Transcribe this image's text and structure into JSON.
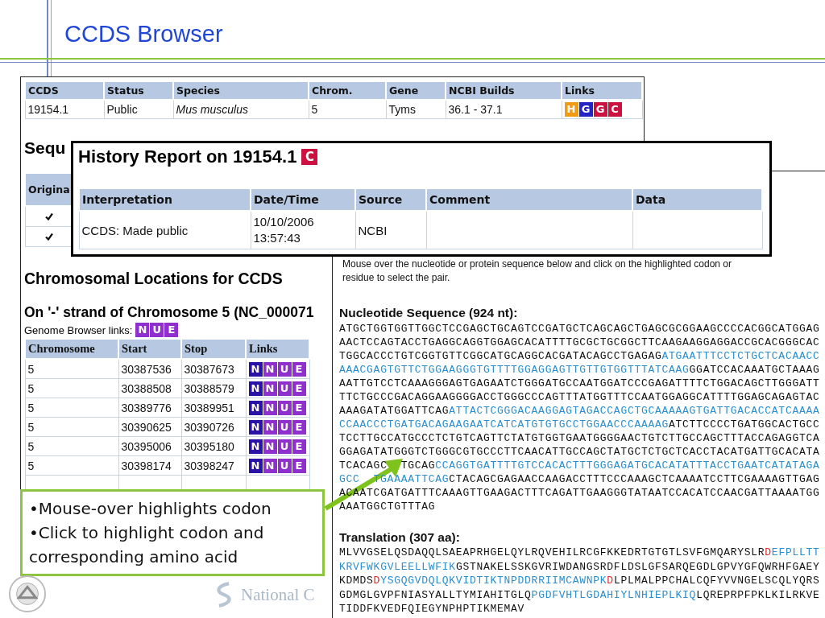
{
  "slide": {
    "title": "CCDS Browser",
    "footer_logo": "National C"
  },
  "ccds_page": {
    "summary_table": {
      "columns": [
        "CCDS",
        "Status",
        "Species",
        "Chrom.",
        "Gene",
        "NCBI Builds",
        "Links"
      ],
      "rows": [
        {
          "ccds": "19154.1",
          "status": "Public",
          "species": "Mus musculus",
          "chrom": "5",
          "gene": "Tyms",
          "ncbi_builds": "36.1 - 37.1",
          "links": [
            {
              "label": "H",
              "color": "#f29a12"
            },
            {
              "label": "G",
              "color": "#2323c8"
            },
            {
              "label": "G",
              "color": "#cc1040"
            },
            {
              "label": "C",
              "color": "#cc1040"
            }
          ]
        }
      ]
    },
    "sequence_heading": "Sequ",
    "original_table": {
      "column": "Origina",
      "rows": [
        {
          "checked": true
        },
        {
          "checked": true
        }
      ]
    },
    "locations_heading": "Chromosomal Locations for CCDS",
    "strand_heading": "On '-' strand of Chromosome 5 (NC_000071",
    "genome_browser": {
      "label": "Genome Browser links:",
      "links": [
        {
          "label": "N",
          "color": "#8e2fce"
        },
        {
          "label": "U",
          "color": "#8e2fce"
        },
        {
          "label": "E",
          "color": "#8e2fce"
        }
      ]
    },
    "locations_table": {
      "columns": [
        "Chromosome",
        "Start",
        "Stop",
        "Links"
      ],
      "rows": [
        {
          "chromosome": "5",
          "start": "30387536",
          "stop": "30387673",
          "links": [
            {
              "label": "N",
              "color": "#2a12a8"
            },
            {
              "label": "N",
              "color": "#8e2fce"
            },
            {
              "label": "U",
              "color": "#8e2fce"
            },
            {
              "label": "E",
              "color": "#8e2fce"
            }
          ]
        },
        {
          "chromosome": "5",
          "start": "30388508",
          "stop": "30388579",
          "links": [
            {
              "label": "N",
              "color": "#2a12a8"
            },
            {
              "label": "N",
              "color": "#8e2fce"
            },
            {
              "label": "U",
              "color": "#8e2fce"
            },
            {
              "label": "E",
              "color": "#8e2fce"
            }
          ]
        },
        {
          "chromosome": "5",
          "start": "30389776",
          "stop": "30389951",
          "links": [
            {
              "label": "N",
              "color": "#2a12a8"
            },
            {
              "label": "N",
              "color": "#8e2fce"
            },
            {
              "label": "U",
              "color": "#8e2fce"
            },
            {
              "label": "E",
              "color": "#8e2fce"
            }
          ]
        },
        {
          "chromosome": "5",
          "start": "30390625",
          "stop": "30390726",
          "links": [
            {
              "label": "N",
              "color": "#2a12a8"
            },
            {
              "label": "N",
              "color": "#8e2fce"
            },
            {
              "label": "U",
              "color": "#8e2fce"
            },
            {
              "label": "E",
              "color": "#8e2fce"
            }
          ]
        },
        {
          "chromosome": "5",
          "start": "30395006",
          "stop": "30395180",
          "links": [
            {
              "label": "N",
              "color": "#2a12a8"
            },
            {
              "label": "N",
              "color": "#8e2fce"
            },
            {
              "label": "U",
              "color": "#8e2fce"
            },
            {
              "label": "E",
              "color": "#8e2fce"
            }
          ]
        },
        {
          "chromosome": "5",
          "start": "30398174",
          "stop": "30398247",
          "links": [
            {
              "label": "N",
              "color": "#2a12a8"
            },
            {
              "label": "N",
              "color": "#8e2fce"
            },
            {
              "label": "U",
              "color": "#8e2fce"
            },
            {
              "label": "E",
              "color": "#8e2fce"
            }
          ]
        }
      ]
    }
  },
  "history_report": {
    "title": "History Report on 19154.1",
    "badge": {
      "label": "C",
      "color": "#cc1040"
    },
    "columns": [
      "Interpretation",
      "Date/Time",
      "Source",
      "Comment",
      "Data"
    ],
    "rows": [
      {
        "interpretation": "CCDS: Made public",
        "date": "10/10/2006",
        "time": "13:57:43",
        "source": "NCBI"
      }
    ]
  },
  "sequence_panel": {
    "instructions": "Mouse over the nucleotide or protein sequence below and click on the highlighted codon or residue to select the pair.",
    "nucleotide": {
      "title": "Nucleotide Sequence (924 nt):",
      "lines": [
        [
          {
            "text": "ATGCTGGTGGTTGGCTCCGAGCTGCAGTCCGATGCTCAGCAGCTGAGCGCGGAAGCCCCACGGCATGGAG",
            "kind": "plain"
          }
        ],
        [
          {
            "text": "AACTCCAGTACCTGAGGCAGGTGGAGCACATTTTGCGCTGCGGCTTCAAGAAGGAGGACCGCACGGGCAC",
            "kind": "plain"
          }
        ],
        [
          {
            "text": "TGGCACCCTGTCGGTGTTCGGCATGCAGGCACGATACAGCCTGAGAG",
            "kind": "plain"
          },
          {
            "text": "ATGAATTTCCTCTGCTCACAACC",
            "kind": "highlight"
          }
        ],
        [
          {
            "text": "AAACGAGTGTTCTGGAAGGGTGTTTTGGAGGAGTTGTTGTGGTTTATCAAG",
            "kind": "highlight"
          },
          {
            "text": "GGATCCACAAATGCTAAAG",
            "kind": "plain"
          }
        ],
        [
          {
            "text": "AATTGTCCTCAAAGGGAGTGAGAATCTGGGATGCCAATGGATCCCGAGATTTTCTGGACAGCTTGGGATT",
            "kind": "plain"
          }
        ],
        [
          {
            "text": "TTCTGCCCGACAGGAAGGGGACCTGGGCCCAGTTTATGGTTTCCAATGGAGGCATTTTGGAGCAGAGTAC",
            "kind": "plain"
          }
        ],
        [
          {
            "text": "AAAGATATGGATTCAG",
            "kind": "plain"
          },
          {
            "text": "ATTACTCGGGACAAGGAGTAGACCAGCTGCAAAAAGTGATTGACACCATCAAAA",
            "kind": "highlight"
          }
        ],
        [
          {
            "text": "CCAACCCTGATGACAGAAGAATCATCATGTGTGCCTGGAACCCAAAAG",
            "kind": "highlight"
          },
          {
            "text": "ATCTTCCCCTGATGGCACTGCC",
            "kind": "plain"
          }
        ],
        [
          {
            "text": "TCCTTGCCATGCCCTCTGTCAGTTCTATGTGGTGAATGGGGAACTGTCTTGCCAGCTTTACCAGAGGTCA",
            "kind": "plain"
          }
        ],
        [
          {
            "text": "GGAGATATGGGTCTGGGCGTGCCCTTCAACATTGCCAGCTATGCTCTGCTCACCTACATGATTGCACATA",
            "kind": "plain"
          }
        ],
        [
          {
            "text": "TCACAGC",
            "kind": "plain"
          },
          {
            "text": "TGCAG",
            "kind": "plain",
            "gap_before": true
          },
          {
            "text": "CCAGGTGATTTTGTCCACACTTTGGGAGATGCACATATTTACCTGAATCATATAGA",
            "kind": "highlight"
          }
        ],
        [
          {
            "text": "GCC",
            "kind": "highlight"
          },
          {
            "text": "TGAAAATTCAG",
            "kind": "highlight",
            "gap_before": true
          },
          {
            "text": "CTACAGCGAGAACCAAGACCTTTCCCAAAGCTCAAAATCCTTCGAAAAGTTGAG",
            "kind": "plain"
          }
        ],
        [
          {
            "text": "ACAATCGATGATTTCAAAGTTGAAGACTTTCAGATTGAAGGGTATAATCCACATCCAACGATTAAAATGG",
            "kind": "plain"
          }
        ],
        [
          {
            "text": "AAATGGCTGTTTAG",
            "kind": "plain"
          }
        ]
      ]
    },
    "translation": {
      "title": "Translation (307 aa):",
      "lines": [
        [
          {
            "text": "MLVVGSELQSDAQQLSAEAPRHGELQYLRQVEHILRCGFKKEDRTGTGTLSVFGMQARYSLR",
            "kind": "plain"
          },
          {
            "text": "D",
            "kind": "selected"
          },
          {
            "text": "EFPLLTT",
            "kind": "highlight"
          }
        ],
        [
          {
            "text": "KRVFWKGVLEELLWFIK",
            "kind": "highlight"
          },
          {
            "text": "GSTNAKELSSKGVRIWDANGSRDFLDSLGFSARQEGDLGPVYGFQWRHFGAEY",
            "kind": "plain"
          }
        ],
        [
          {
            "text": "KDMDS",
            "kind": "plain"
          },
          {
            "text": "D",
            "kind": "selected"
          },
          {
            "text": "YSGQGVDQLQKVIDTIKTNPDDRRIIMCAWNPK",
            "kind": "highlight"
          },
          {
            "text": "D",
            "kind": "selected"
          },
          {
            "text": "LPLMALPPCHALCQFYVVNGELSCQLYQRS",
            "kind": "plain"
          }
        ],
        [
          {
            "text": "GDMGLGVPFNIASYALLTYMIAHITGLQ",
            "kind": "plain"
          },
          {
            "text": "PGDFVHTLGDAHIYLNHIEPLKIQ",
            "kind": "highlight"
          },
          {
            "text": "LQREPRPFPKLKILRKVE",
            "kind": "plain"
          }
        ],
        [
          {
            "text": "TIDDFKVEDFQIEGYNPHPTIKMEMAV",
            "kind": "plain"
          }
        ]
      ]
    }
  },
  "callout": {
    "bullets": [
      "•Mouse-over highlights codon",
      "•Click to highlight codon and corresponding amino acid"
    ]
  }
}
